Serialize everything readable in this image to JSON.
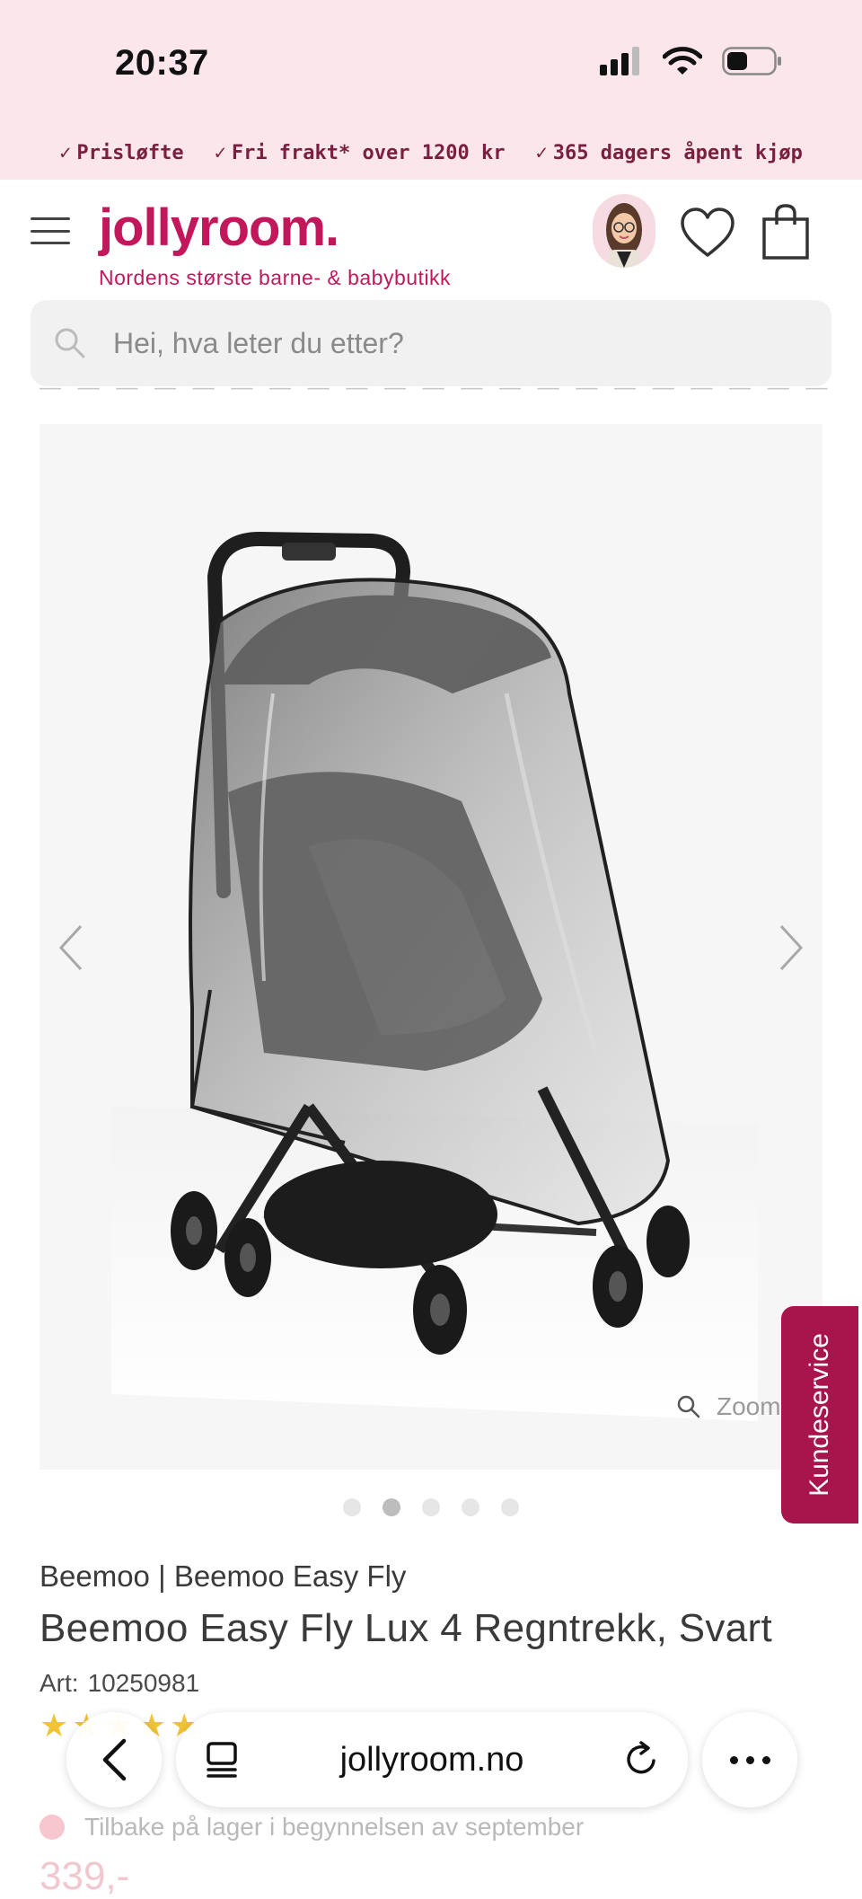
{
  "status_bar": {
    "time": "20:37"
  },
  "usp_bar": {
    "items": [
      {
        "label": "Prisløfte"
      },
      {
        "label": "Fri frakt* over 1200 kr"
      },
      {
        "label": "365 dagers åpent kjøp"
      }
    ]
  },
  "header": {
    "logo": "jollyroom.",
    "tagline": "Nordens største barne- & babybutikk"
  },
  "search": {
    "placeholder": "Hei, hva leter du etter?"
  },
  "gallery": {
    "zoom_label": "Zoom",
    "dots_count": 5,
    "active_dot": 2
  },
  "customer_service": {
    "label": "Kundeservice"
  },
  "product": {
    "brand_line": "Beemoo | Beemoo Easy Fly",
    "title": "Beemoo Easy Fly Lux 4 Regntrekk, Svart",
    "art_label": "Art:",
    "art_number": "10250981",
    "stock_text": "Tilbake på lager i begynnelsen av september",
    "price_partial": "339,-"
  },
  "browser": {
    "url": "jollyroom.no"
  },
  "colors": {
    "brand": "#c2185b",
    "usp_bg": "#fbe6ec",
    "customer_service_bg": "#a8154d",
    "star": "#f0c437"
  }
}
